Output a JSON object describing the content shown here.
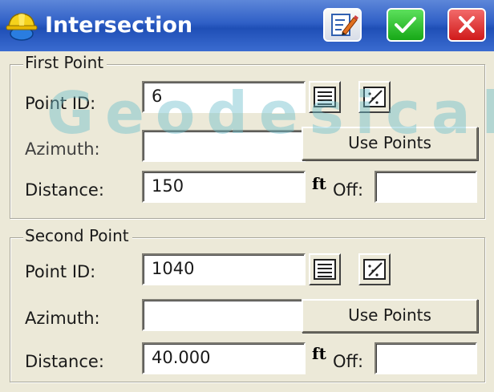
{
  "window": {
    "title": "Intersection"
  },
  "titlebar": {
    "app_icon": "surveyor-hardhat-icon",
    "buttons": [
      {
        "name": "edit-note-button",
        "icon": "notepad-pencil-icon"
      },
      {
        "name": "ok-button",
        "icon": "checkmark-icon",
        "color": "#22b822"
      },
      {
        "name": "close-button",
        "icon": "x-close-icon",
        "color": "#e02020"
      }
    ]
  },
  "watermark": "Geodesical",
  "first_point": {
    "group_label": "First Point",
    "point_id_label": "Point ID:",
    "point_id_value": "6",
    "azimuth_label": "Azimuth:",
    "azimuth_value": "",
    "use_points_label": "Use Points",
    "distance_label": "Distance:",
    "distance_value": "150",
    "distance_unit": "ft",
    "offset_label": "Off:",
    "offset_value": ""
  },
  "second_point": {
    "group_label": "Second Point",
    "point_id_label": "Point ID:",
    "point_id_value": "1040",
    "azimuth_label": "Azimuth:",
    "azimuth_value": "",
    "use_points_label": "Use Points",
    "distance_label": "Distance:",
    "distance_value": "40.000",
    "distance_unit": "ft",
    "offset_label": "Off:",
    "offset_value": ""
  },
  "colors": {
    "titlebar": "#2f5fc6",
    "background": "#ece9d8",
    "ok": "#22b822",
    "close": "#e02020"
  }
}
